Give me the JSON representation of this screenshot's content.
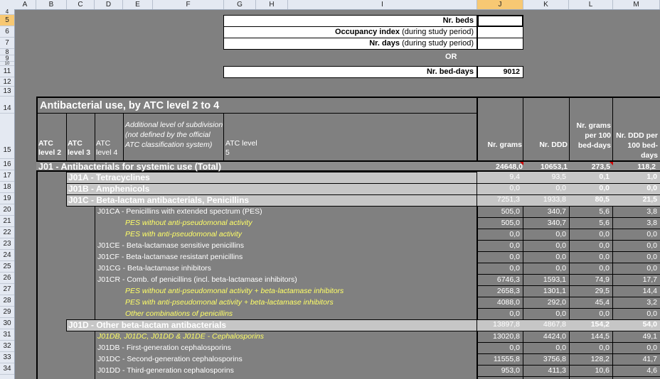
{
  "columns": [
    "A",
    "B",
    "C",
    "D",
    "E",
    "F",
    "G",
    "H",
    "I",
    "J",
    "K",
    "L",
    "M"
  ],
  "selected_column": "J",
  "rows": [
    "4",
    "5",
    "6",
    "7",
    "8",
    "9",
    "10",
    "11",
    "12",
    "13",
    "14",
    "15",
    "16",
    "17",
    "18",
    "19",
    "20",
    "21",
    "22",
    "23",
    "24",
    "25",
    "26",
    "27",
    "28",
    "29",
    "30",
    "31",
    "32",
    "33",
    "34"
  ],
  "selected_row": "5",
  "top_inputs": {
    "nr_beds_label": "Nr. beds",
    "nr_beds_value": "",
    "occupancy_label_bold": "Occupancy index",
    "occupancy_label_rest": " (during study period)",
    "occupancy_value": "",
    "nr_days_label_bold": "Nr. days",
    "nr_days_label_rest": " (during study period)",
    "nr_days_value": "",
    "or_text": "OR",
    "bed_days_label": "Nr. bed-days",
    "bed_days_value": "9012"
  },
  "table": {
    "title": "Antibacterial use, by ATC level 2 to 4",
    "headers": {
      "atc2": "ATC level 2",
      "atc3": "ATC level 3",
      "atc4": "ATC level 4",
      "additional": "Additional level of subdivision (not defined by the official ATC classification system)",
      "atc5": "ATC level 5",
      "grams": "Nr. grams",
      "ddd": "Nr. DDD",
      "grams100": "Nr. grams per 100 bed-days",
      "ddd100": "Nr. DDD per 100 bed-days"
    },
    "total": {
      "label": "J01 - Antibacterials for systemic use (Total)",
      "grams": "24648,0",
      "ddd": "10653,1",
      "g100": "273,5",
      "d100": "118,2"
    },
    "bands": [
      {
        "label": "J01A - Tetracyclines",
        "grams": "9,4",
        "ddd": "93,5",
        "g100": "0,1",
        "d100": "1,0"
      },
      {
        "label": "J01B - Amphenicols",
        "grams": "0,0",
        "ddd": "0,0",
        "g100": "0,0",
        "d100": "0,0"
      },
      {
        "label": "J01C - Beta-lactam antibacterials, Penicillins",
        "grams": "7251,3",
        "ddd": "1933,8",
        "g100": "80,5",
        "d100": "21,5"
      }
    ],
    "penicillin_rows": [
      {
        "label": "J01CA - Penicillins with extended spectrum (PES)",
        "grams": "505,0",
        "ddd": "340,7",
        "g100": "5,6",
        "d100": "3,8"
      },
      {
        "label": "PES without anti-pseudomonal activity",
        "grams": "505,0",
        "ddd": "340,7",
        "g100": "5,6",
        "d100": "3,8"
      },
      {
        "label": "PES with anti-pseudomonal activity",
        "grams": "0,0",
        "ddd": "0,0",
        "g100": "0,0",
        "d100": "0,0"
      },
      {
        "label": "J01CE - Beta-lactamase sensitive penicillins",
        "grams": "0,0",
        "ddd": "0,0",
        "g100": "0,0",
        "d100": "0,0"
      },
      {
        "label": "J01CF - Beta-lactamase resistant penicillins",
        "grams": "0,0",
        "ddd": "0,0",
        "g100": "0,0",
        "d100": "0,0"
      },
      {
        "label": "J01CG - Beta-lactamase inhibitors",
        "grams": "0,0",
        "ddd": "0,0",
        "g100": "0,0",
        "d100": "0,0"
      },
      {
        "label": "J01CR - Comb. of penicillins (incl. beta-lactamase inhibitors)",
        "grams": "6746,3",
        "ddd": "1593,1",
        "g100": "74,9",
        "d100": "17,7"
      },
      {
        "label": "PES without anti-pseudomonal activity + beta-lactamase inhibitors",
        "grams": "2658,3",
        "ddd": "1301,1",
        "g100": "29,5",
        "d100": "14,4"
      },
      {
        "label": "PES with anti-pseudomonal activity + beta-lactamase inhibitors",
        "grams": "4088,0",
        "ddd": "292,0",
        "g100": "45,4",
        "d100": "3,2"
      },
      {
        "label": "Other combinations of penicillins",
        "grams": "0,0",
        "ddd": "0,0",
        "g100": "0,0",
        "d100": "0,0"
      }
    ],
    "band_d": {
      "label": "J01D - Other beta-lactam antibacterials",
      "grams": "13897,8",
      "ddd": "4867,8",
      "g100": "154,2",
      "d100": "54,0"
    },
    "d_rows": [
      {
        "label": "J01DB, J01DC, J01DD & J01DE - Cephalosporins",
        "grams": "13020,8",
        "ddd": "4424,0",
        "g100": "144,5",
        "d100": "49,1"
      },
      {
        "label": "J01DB - First-generation cephalosporins",
        "grams": "0,0",
        "ddd": "0,0",
        "g100": "0,0",
        "d100": "0,0"
      },
      {
        "label": "J01DC - Second-generation cephalosporins",
        "grams": "11555,8",
        "ddd": "3756,8",
        "g100": "128,2",
        "d100": "41,7"
      },
      {
        "label": "J01DD - Third-generation cephalosporins",
        "grams": "953,0",
        "ddd": "411,3",
        "g100": "10,6",
        "d100": "4,6"
      }
    ]
  }
}
